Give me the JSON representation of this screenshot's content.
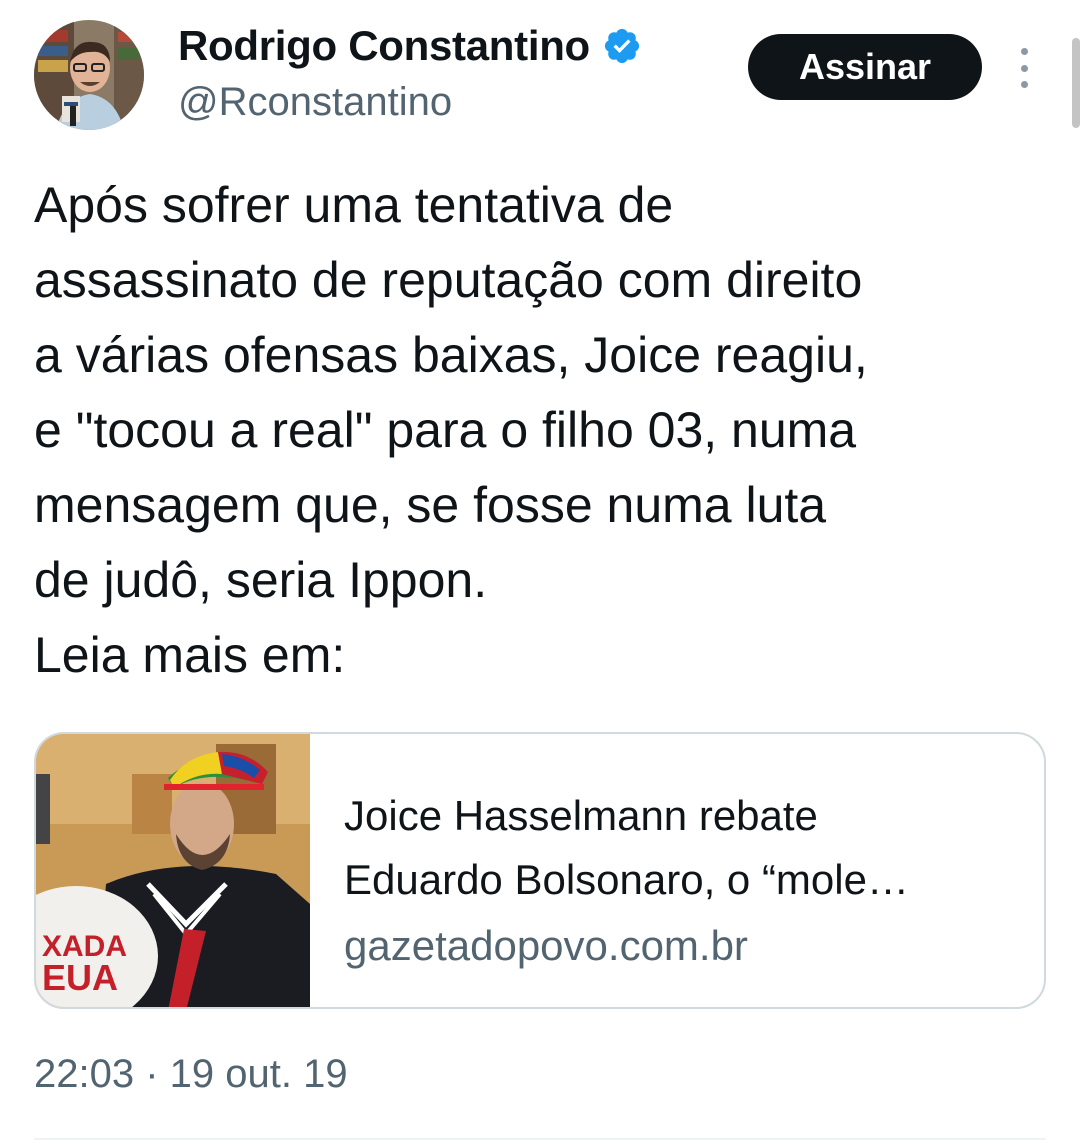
{
  "author": {
    "name": "Rodrigo Constantino",
    "handle": "@Rconstantino",
    "verified_icon": "verified-badge-icon",
    "verified_color": "#1d9bf0"
  },
  "header": {
    "follow_label": "Assinar",
    "more_icon": "more-vertical-icon"
  },
  "tweet": {
    "lines": [
      "Após sofrer uma tentativa de",
      "assassinato de reputação com direito",
      "a várias ofensas baixas, Joice reagiu,",
      "e \"tocou a real\" para o filho 03, numa",
      "mensagem que, se fosse numa luta",
      "de judô, seria Ippon.",
      "Leia mais em:"
    ]
  },
  "link_card": {
    "title_lines": [
      "Joice Hasselmann rebate",
      "Eduardo Bolsonaro, o “mole…"
    ],
    "domain": "gazetadopovo.com.br",
    "thumbnail_text": [
      "XADA",
      "EUA"
    ]
  },
  "meta": {
    "timestamp": "22:03 · 19 out. 19"
  },
  "colors": {
    "text": "#0f1419",
    "secondary": "#536471",
    "accent": "#1d9bf0",
    "button_bg": "#0f1419",
    "border": "#cfd9de"
  }
}
